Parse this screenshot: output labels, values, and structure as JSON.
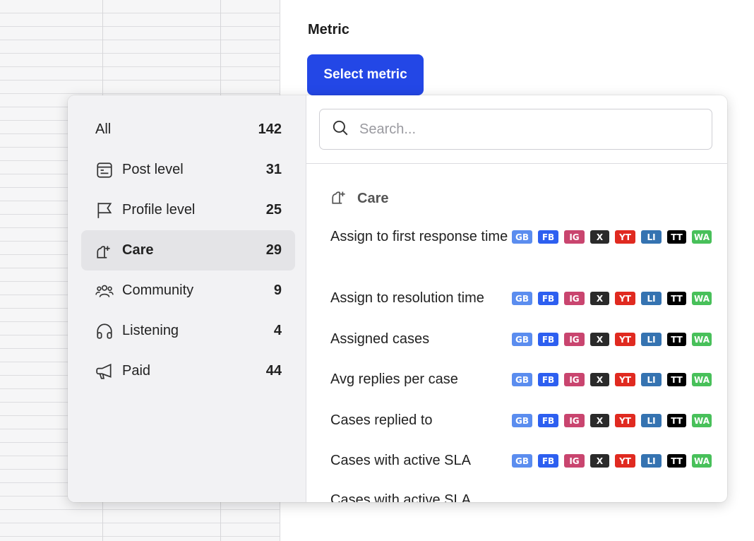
{
  "header": {
    "metric_label": "Metric",
    "select_button": "Select metric"
  },
  "categories": [
    {
      "label": "All",
      "count": "142",
      "icon": ""
    },
    {
      "label": "Post level",
      "count": "31",
      "icon": "post-icon"
    },
    {
      "label": "Profile level",
      "count": "25",
      "icon": "flag-icon"
    },
    {
      "label": "Care",
      "count": "29",
      "icon": "care-icon",
      "active": true
    },
    {
      "label": "Community",
      "count": "9",
      "icon": "community-icon"
    },
    {
      "label": "Listening",
      "count": "4",
      "icon": "headphones-icon"
    },
    {
      "label": "Paid",
      "count": "44",
      "icon": "megaphone-icon"
    }
  ],
  "search": {
    "placeholder": "Search...",
    "value": ""
  },
  "section": {
    "title": "Care"
  },
  "networks": [
    {
      "code": "GB",
      "color": "#5b8def"
    },
    {
      "code": "FB",
      "color": "#2d5ff0"
    },
    {
      "code": "IG",
      "color": "#c9456f"
    },
    {
      "code": "X",
      "color": "#2a2a2a"
    },
    {
      "code": "YT",
      "color": "#e02a20"
    },
    {
      "code": "LI",
      "color": "#3573b1"
    },
    {
      "code": "TT",
      "color": "#000000"
    },
    {
      "code": "WA",
      "color": "#48c05a"
    }
  ],
  "metrics": [
    {
      "name": "Assign to first response time"
    },
    {
      "name": "Assign to resolution time"
    },
    {
      "name": "Assigned cases"
    },
    {
      "name": "Avg replies per case"
    },
    {
      "name": "Cases replied to"
    },
    {
      "name": "Cases with active SLA"
    }
  ],
  "cut_off_row": "Cases with active SLA"
}
